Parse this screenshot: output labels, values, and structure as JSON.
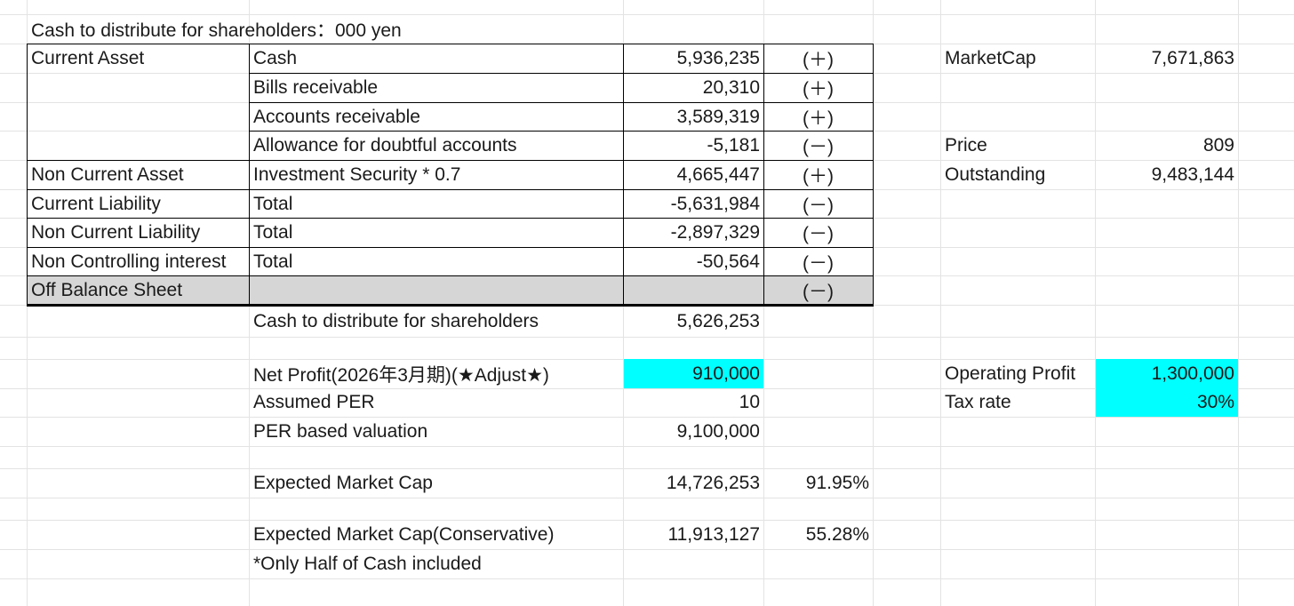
{
  "sheet": {
    "title": "Cash to distribute for shareholders：000 yen",
    "rows": [
      {
        "category": "Current Asset",
        "item": "Cash",
        "value": "5,936,235",
        "sign": "(＋)"
      },
      {
        "category": "",
        "item": "Bills receivable",
        "value": "20,310",
        "sign": "(＋)"
      },
      {
        "category": "",
        "item": "Accounts receivable",
        "value": "3,589,319",
        "sign": "(＋)"
      },
      {
        "category": "",
        "item": "Allowance for doubtful accounts",
        "value": "-5,181",
        "sign": "(－)"
      },
      {
        "category": "Non Current Asset",
        "item": "Investment Security * 0.7",
        "value": "4,665,447",
        "sign": "(＋)"
      },
      {
        "category": "Current Liability",
        "item": "Total",
        "value": "-5,631,984",
        "sign": "(－)"
      },
      {
        "category": "Non Current Liability",
        "item": "Total",
        "value": "-2,897,329",
        "sign": "(－)"
      },
      {
        "category": "Non Controlling interest",
        "item": "Total",
        "value": "-50,564",
        "sign": "(－)"
      },
      {
        "category": "Off Balance Sheet",
        "item": "",
        "value": "",
        "sign": "(－)"
      }
    ],
    "cash_total": {
      "label": "Cash to distribute for shareholders",
      "value": "5,626,253"
    },
    "net_profit": {
      "label": "Net Profit(2026年3月期)(★Adjust★)",
      "value": "910,000"
    },
    "assumed_per": {
      "label": "Assumed PER",
      "value": "10"
    },
    "per_valuation": {
      "label": "PER based valuation",
      "value": "9,100,000"
    },
    "expected_cap": {
      "label": "Expected Market Cap",
      "value": "14,726,253",
      "pct": "91.95%"
    },
    "expected_cap_cons": {
      "label": "Expected Market Cap(Conservative)",
      "value": "11,913,127",
      "pct": "55.28%"
    },
    "note": "*Only Half of Cash included",
    "market_cap": {
      "label": "MarketCap",
      "value": "7,671,863"
    },
    "price": {
      "label": "Price",
      "value": "809"
    },
    "outstanding": {
      "label": "Outstanding",
      "value": "9,483,144"
    },
    "operating_profit": {
      "label": "Operating Profit",
      "value": "1,300,000"
    },
    "tax_rate": {
      "label": "Tax rate",
      "value": "30%"
    }
  },
  "colors": {
    "highlight": "#00ffff",
    "shaded": "#d6d6d6"
  }
}
